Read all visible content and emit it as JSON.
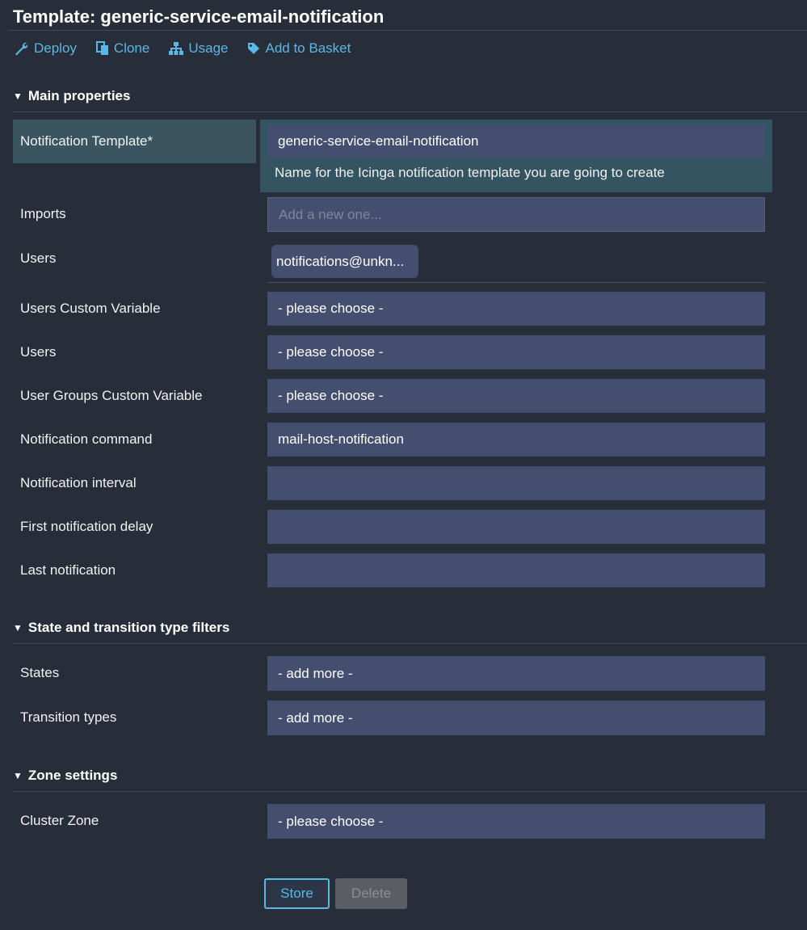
{
  "page": {
    "title": "Template: generic-service-email-notification"
  },
  "actions": [
    {
      "label": "Deploy",
      "icon": "wrench-icon"
    },
    {
      "label": "Clone",
      "icon": "copy-icon"
    },
    {
      "label": "Usage",
      "icon": "sitemap-icon"
    },
    {
      "label": "Add to Basket",
      "icon": "tag-icon"
    }
  ],
  "sections": {
    "main": "Main properties",
    "filters": "State and transition type filters",
    "zone": "Zone settings"
  },
  "main": {
    "notification_template": {
      "label": "Notification Template*",
      "value": "generic-service-email-notification",
      "hint": "Name for the Icinga notification template you are going to create"
    },
    "imports": {
      "label": "Imports",
      "placeholder": "Add a new one..."
    },
    "users": {
      "label": "Users",
      "chip": "notifications@unkn..."
    },
    "users_custom_variable": {
      "label": "Users Custom Variable",
      "value": "- please choose -"
    },
    "users_select": {
      "label": "Users",
      "value": "- please choose -"
    },
    "user_groups_custom_variable": {
      "label": "User Groups Custom Variable",
      "value": "- please choose -"
    },
    "notification_command": {
      "label": "Notification command",
      "value": "mail-host-notification"
    },
    "notification_interval": {
      "label": "Notification interval",
      "value": ""
    },
    "first_notification_delay": {
      "label": "First notification delay",
      "value": ""
    },
    "last_notification": {
      "label": "Last notification",
      "value": ""
    }
  },
  "filters": {
    "states": {
      "label": "States",
      "value": "- add more -"
    },
    "transition_types": {
      "label": "Transition types",
      "value": "- add more -"
    }
  },
  "zone": {
    "cluster_zone": {
      "label": "Cluster Zone",
      "value": "- please choose -"
    }
  },
  "buttons": {
    "store": "Store",
    "delete": "Delete"
  },
  "colors": {
    "background": "#282e39",
    "accent": "#5ab7e6",
    "field": "#444e6f",
    "highlight": "#345461"
  }
}
